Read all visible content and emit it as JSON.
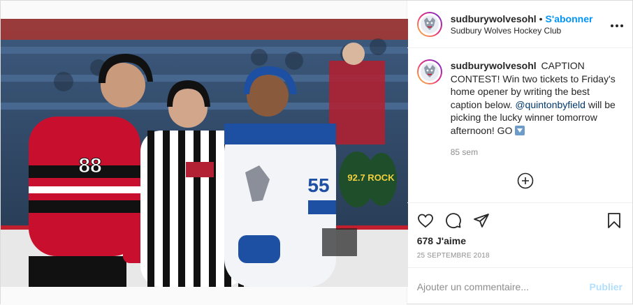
{
  "post": {
    "username": "sudburywolvesohl",
    "separator": "•",
    "follow_label": "S'abonner",
    "location": "Sudbury Wolves Hockey Club",
    "caption_username": "sudburywolvesohl",
    "caption_text_1": "CAPTION CONTEST! Win two tickets to Friday's home opener by writing the best caption below.",
    "caption_mention": "@quintonbyfield",
    "caption_text_2": "will be picking the lucky winner tomorrow afternoon! GO",
    "time_ago": "85 sem",
    "likes": "678 J'aime",
    "date": "25 SEPTEMBRE 2018",
    "comment_placeholder": "Ajouter un commentaire...",
    "publish_label": "Publier"
  },
  "photo": {
    "left_jersey_number": "88",
    "right_jersey_number": "55",
    "sign_text": "92.7 ROCK"
  },
  "icons": {
    "more": "more-options-icon",
    "like": "heart-icon",
    "comment": "comment-icon",
    "share": "share-icon",
    "save": "bookmark-icon",
    "add": "plus-circle-icon"
  }
}
